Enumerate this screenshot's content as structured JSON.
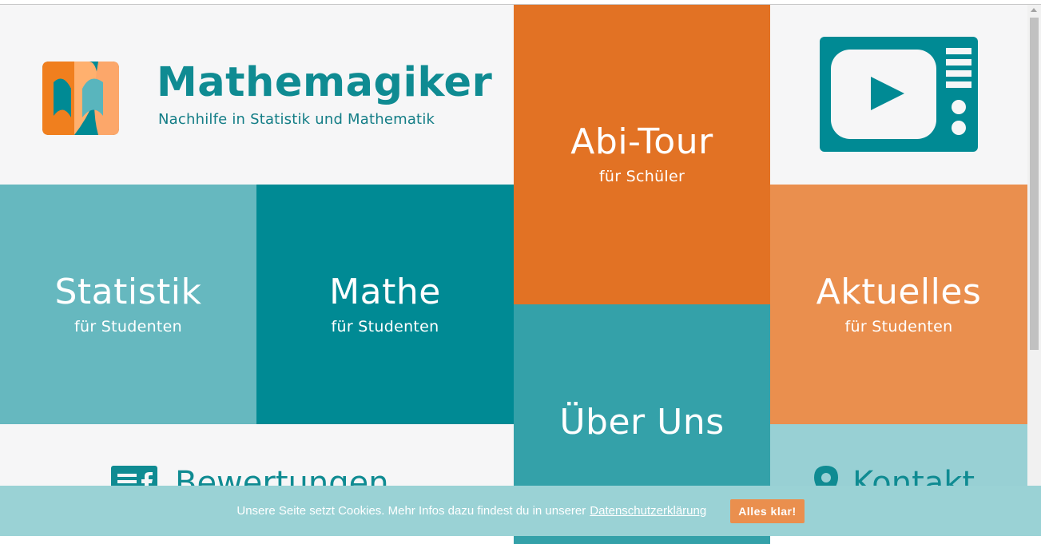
{
  "brand": {
    "name": "Mathemagiker",
    "tagline": "Nachhilfe in Statistik und Mathematik"
  },
  "tiles": {
    "statistik": {
      "title": "Statistik",
      "subtitle": "für Studenten"
    },
    "mathe": {
      "title": "Mathe",
      "subtitle": "für Studenten"
    },
    "abitour": {
      "title": "Abi-Tour",
      "subtitle": "für Schüler"
    },
    "aktuelles": {
      "title": "Aktuelles",
      "subtitle": "für Studenten"
    },
    "ueberuns": {
      "title": "Über Uns"
    },
    "bewertungen": {
      "title": "Bewertungen"
    },
    "kontakt": {
      "title": "Kontakt"
    }
  },
  "icons": {
    "logo": "mathemagiker-logo-icon",
    "video": "tv-play-icon",
    "reviews": "facebook-reviews-icon",
    "location": "map-pin-icon"
  },
  "cookie": {
    "text": "Unsere Seite setzt Cookies. Mehr Infos dazu findest du in unserer",
    "link": "Datenschutzerklärung",
    "button": "Alles klar!"
  },
  "colors": {
    "teal_dark": "#008a94",
    "teal_light": "#66b8bf",
    "teal_mid": "#34a1a9",
    "orange": "#e27224",
    "orange_light": "#ea8f4e",
    "cookie_bg": "#9ad2d5"
  }
}
